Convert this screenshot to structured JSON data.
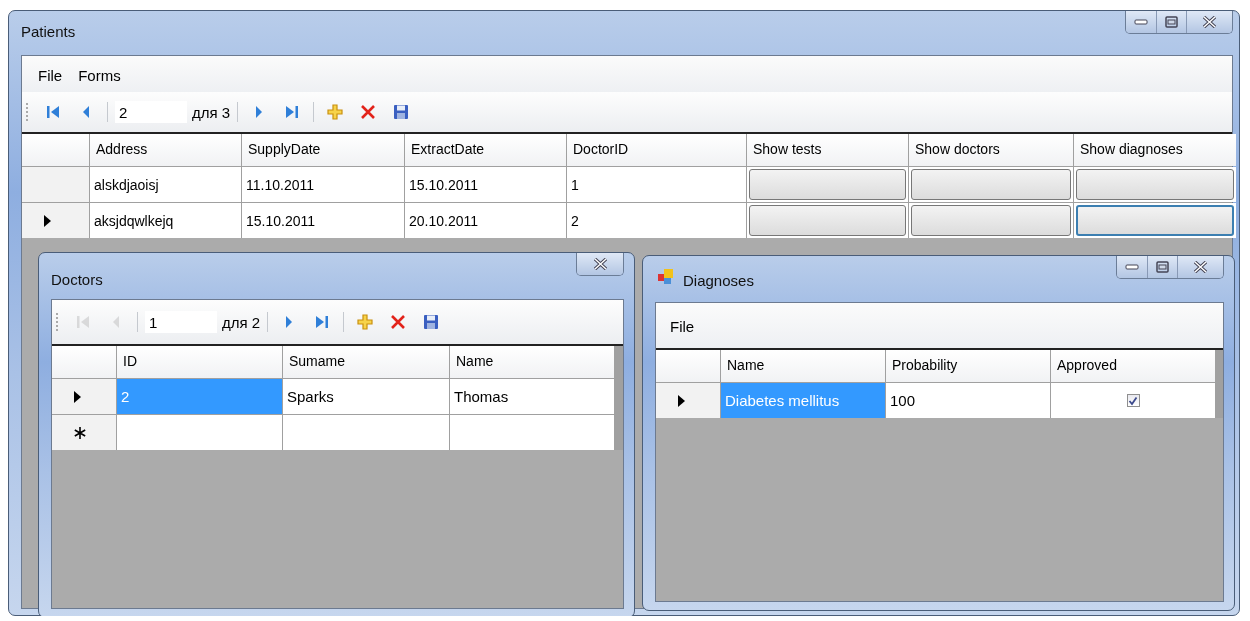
{
  "patients": {
    "title": "Patients",
    "caption_buttons": [
      {
        "kind": "minimize"
      },
      {
        "kind": "maximize"
      },
      {
        "kind": "close"
      }
    ],
    "menu": [
      {
        "label": "File"
      },
      {
        "label": "Forms"
      }
    ],
    "toolbar": [
      {
        "kind": "first",
        "disabled": false
      },
      {
        "kind": "prev",
        "disabled": false
      },
      {
        "kind": "separator"
      },
      {
        "kind": "position",
        "value": "2"
      },
      {
        "kind": "count",
        "text": "для 3"
      },
      {
        "kind": "separator"
      },
      {
        "kind": "next",
        "disabled": false
      },
      {
        "kind": "last",
        "disabled": false
      },
      {
        "kind": "separator"
      },
      {
        "kind": "add",
        "disabled": false
      },
      {
        "kind": "delete",
        "disabled": false
      },
      {
        "kind": "save",
        "disabled": false
      }
    ],
    "grid": {
      "columns": [
        {
          "label": "Address"
        },
        {
          "label": "SupplyDate"
        },
        {
          "label": "ExtractDate"
        },
        {
          "label": "DoctorID"
        },
        {
          "label": "Show tests"
        },
        {
          "label": "Show doctors"
        },
        {
          "label": "Show diagnoses"
        }
      ],
      "rows": [
        {
          "kind": "data",
          "current": false,
          "cells": [
            {
              "kind": "text",
              "text": "alskdjaoisj",
              "selected": false
            },
            {
              "kind": "text",
              "text": "11.10.2011",
              "selected": false
            },
            {
              "kind": "text",
              "text": "15.10.2011",
              "selected": false
            },
            {
              "kind": "text",
              "text": "1",
              "selected": false
            },
            {
              "kind": "button",
              "selected": false
            },
            {
              "kind": "button",
              "selected": false
            },
            {
              "kind": "button",
              "selected": false
            }
          ]
        },
        {
          "kind": "data",
          "current": true,
          "cells": [
            {
              "kind": "text",
              "text": "aksjdqwlkejq",
              "selected": false
            },
            {
              "kind": "text",
              "text": "15.10.2011",
              "selected": false
            },
            {
              "kind": "text",
              "text": "20.10.2011",
              "selected": false
            },
            {
              "kind": "text",
              "text": "2",
              "selected": false
            },
            {
              "kind": "button",
              "selected": false
            },
            {
              "kind": "button",
              "selected": false
            },
            {
              "kind": "button",
              "selected": true
            }
          ]
        }
      ]
    }
  },
  "doctors": {
    "title": "Doctors",
    "caption_buttons": [
      {
        "kind": "close"
      }
    ],
    "toolbar": [
      {
        "kind": "first",
        "disabled": true
      },
      {
        "kind": "prev",
        "disabled": true
      },
      {
        "kind": "separator"
      },
      {
        "kind": "position",
        "value": "1"
      },
      {
        "kind": "count",
        "text": "для 2"
      },
      {
        "kind": "separator"
      },
      {
        "kind": "next",
        "disabled": false
      },
      {
        "kind": "last",
        "disabled": false
      },
      {
        "kind": "separator"
      },
      {
        "kind": "add",
        "disabled": false
      },
      {
        "kind": "delete",
        "disabled": false
      },
      {
        "kind": "save",
        "disabled": false
      }
    ],
    "grid": {
      "columns": [
        {
          "label": "ID"
        },
        {
          "label": "Sumame"
        },
        {
          "label": "Name"
        }
      ],
      "rows": [
        {
          "kind": "data",
          "current": true,
          "cells": [
            {
              "kind": "text",
              "text": "2",
              "selected": true
            },
            {
              "kind": "text",
              "text": "Sparks",
              "selected": false
            },
            {
              "kind": "text",
              "text": "Thomas",
              "selected": false
            }
          ]
        },
        {
          "kind": "new",
          "current": false
        }
      ]
    }
  },
  "diagnoses": {
    "title": "Diagnoses",
    "app_icon": true,
    "caption_buttons": [
      {
        "kind": "minimize"
      },
      {
        "kind": "maximize"
      },
      {
        "kind": "close"
      }
    ],
    "menu": [
      {
        "label": "File"
      }
    ],
    "grid": {
      "columns": [
        {
          "label": "Name"
        },
        {
          "label": "Probability"
        },
        {
          "label": "Approved"
        }
      ],
      "rows": [
        {
          "kind": "data",
          "current": true,
          "cells": [
            {
              "kind": "text",
              "text": "Diabetes mellitus",
              "selected": true
            },
            {
              "kind": "text",
              "text": "100",
              "selected": false
            },
            {
              "kind": "checkbox",
              "checked": true,
              "selected": false
            }
          ]
        }
      ]
    }
  }
}
